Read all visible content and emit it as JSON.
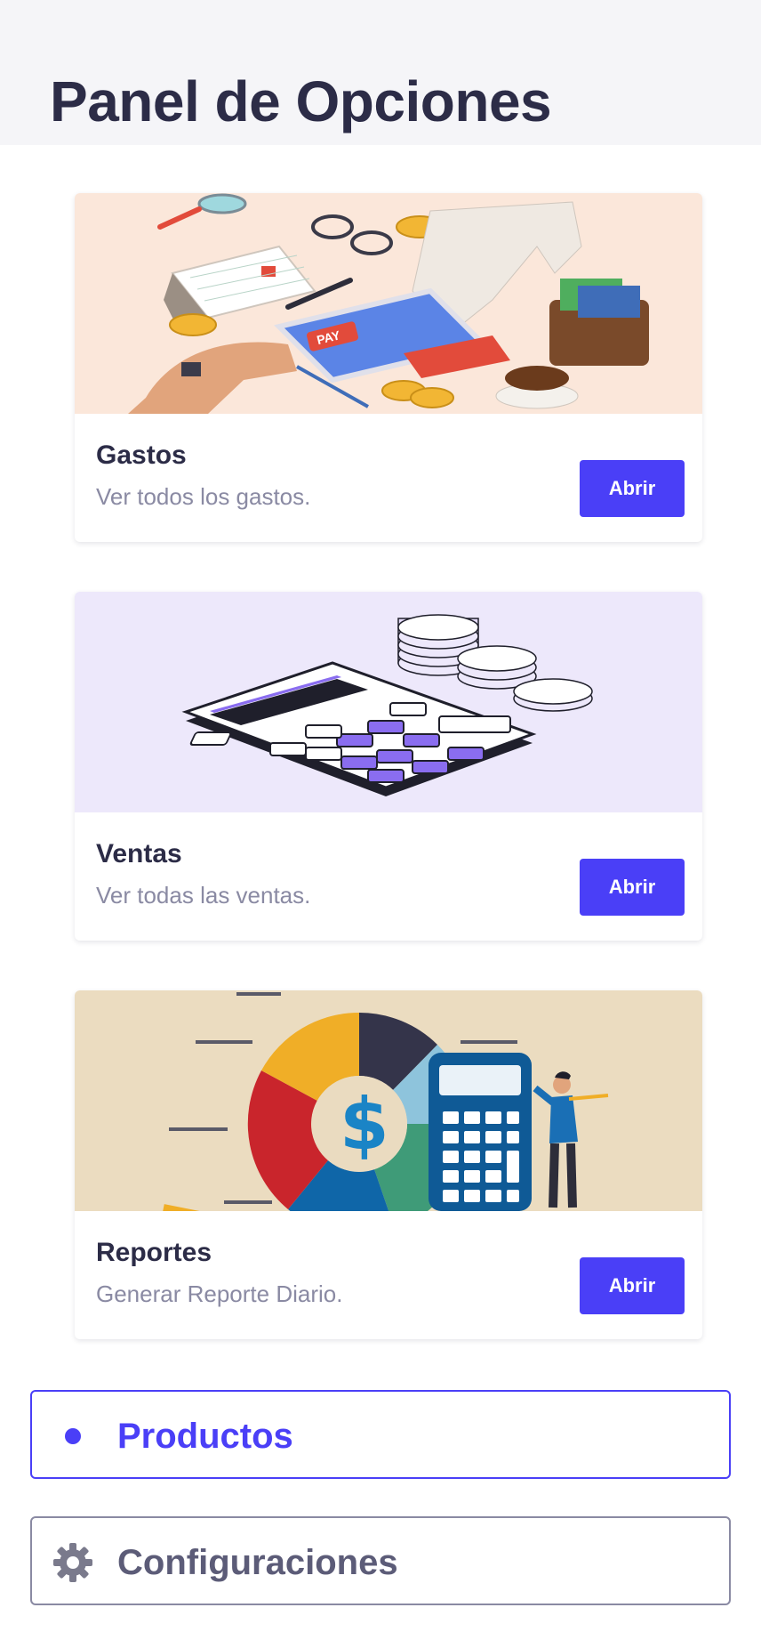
{
  "header": {
    "title": "Panel de Opciones"
  },
  "cards": [
    {
      "title": "Gastos",
      "description": "Ver todos los gastos.",
      "button_label": "Abrir",
      "image_label": "PAY",
      "image_bg": "#fbe7da"
    },
    {
      "title": "Ventas",
      "description": "Ver todas las ventas.",
      "button_label": "Abrir",
      "image_bg": "#ede8fb"
    },
    {
      "title": "Reportes",
      "description": "Generar Reporte Diario.",
      "button_label": "Abrir",
      "image_bg": "#ebdcc0"
    }
  ],
  "nav": {
    "items": [
      {
        "label": "Productos",
        "icon": "bullet-icon",
        "active": true
      },
      {
        "label": "Configuraciones",
        "icon": "gear-icon",
        "active": false
      }
    ]
  },
  "colors": {
    "accent": "#4a3ff7",
    "title_text": "#2c2c47",
    "muted_text": "#8a8aa3",
    "header_bg": "#f5f5f8"
  }
}
